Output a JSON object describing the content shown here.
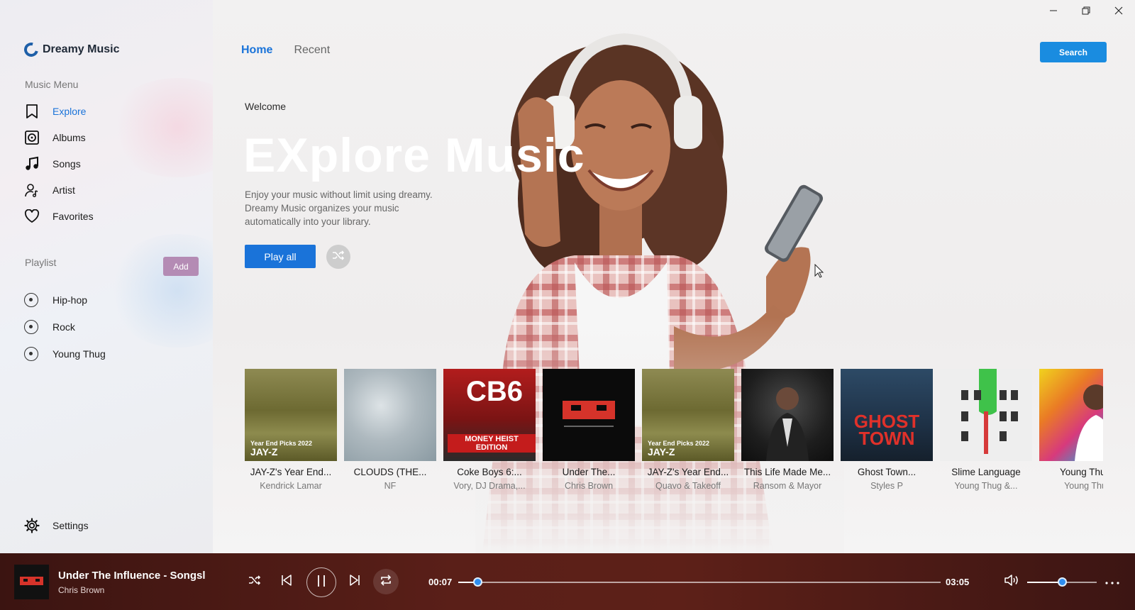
{
  "app": {
    "name": "Dreamy Music",
    "accent_color": "#1a73d9",
    "window_controls": [
      "minimize-icon",
      "restore-icon",
      "close-icon"
    ]
  },
  "sidebar": {
    "menu_label": "Music Menu",
    "items": [
      {
        "label": "Explore",
        "icon": "bookmark-icon",
        "active": true
      },
      {
        "label": "Albums",
        "icon": "album-icon",
        "active": false
      },
      {
        "label": "Songs",
        "icon": "music-note-icon",
        "active": false
      },
      {
        "label": "Artist",
        "icon": "artist-icon",
        "active": false
      },
      {
        "label": "Favorites",
        "icon": "heart-icon",
        "active": false
      }
    ],
    "playlist_label": "Playlist",
    "add_label": "Add",
    "playlists": [
      {
        "label": "Hip-hop"
      },
      {
        "label": "Rock"
      },
      {
        "label": "Young Thug"
      }
    ],
    "settings_label": "Settings"
  },
  "header": {
    "tabs": [
      {
        "label": "Home",
        "active": true
      },
      {
        "label": "Recent",
        "active": false
      }
    ],
    "search_label": "Search"
  },
  "hero": {
    "welcome": "Welcome",
    "title": "EXplore Music",
    "description": "Enjoy your music without limit using dreamy. Dreamy Music organizes your music automatically into your library.",
    "play_all_label": "Play all"
  },
  "albums": [
    {
      "title": "JAY-Z's Year End...",
      "artist": "Kendrick Lamar",
      "cover_text_1": "Year End Picks 2022",
      "cover_text_2": "JAY-Z"
    },
    {
      "title": "CLOUDS (THE...",
      "artist": "NF"
    },
    {
      "title": "Coke Boys 6:...",
      "artist": "Vory, DJ Drama,...",
      "cover_text_1": "CB6",
      "cover_text_2": "MONEY HEIST EDITION"
    },
    {
      "title": "Under The...",
      "artist": "Chris Brown"
    },
    {
      "title": "JAY-Z's Year End...",
      "artist": "Quavo & Takeoff",
      "cover_text_1": "Year End Picks 2022",
      "cover_text_2": "JAY-Z"
    },
    {
      "title": "This Life Made Me...",
      "artist": "Ransom & Mayor"
    },
    {
      "title": "Ghost Town...",
      "artist": "Styles P",
      "cover_text_1": "GHOST TOWN"
    },
    {
      "title": "Slime Language",
      "artist": "Young Thug &..."
    },
    {
      "title": "Young Thug",
      "artist": "Young Thu"
    }
  ],
  "player": {
    "title": "Under The Influence - Songsl",
    "artist": "Chris Brown",
    "elapsed": "00:07",
    "duration": "03:05",
    "progress": 0.04,
    "volume": 0.5
  }
}
